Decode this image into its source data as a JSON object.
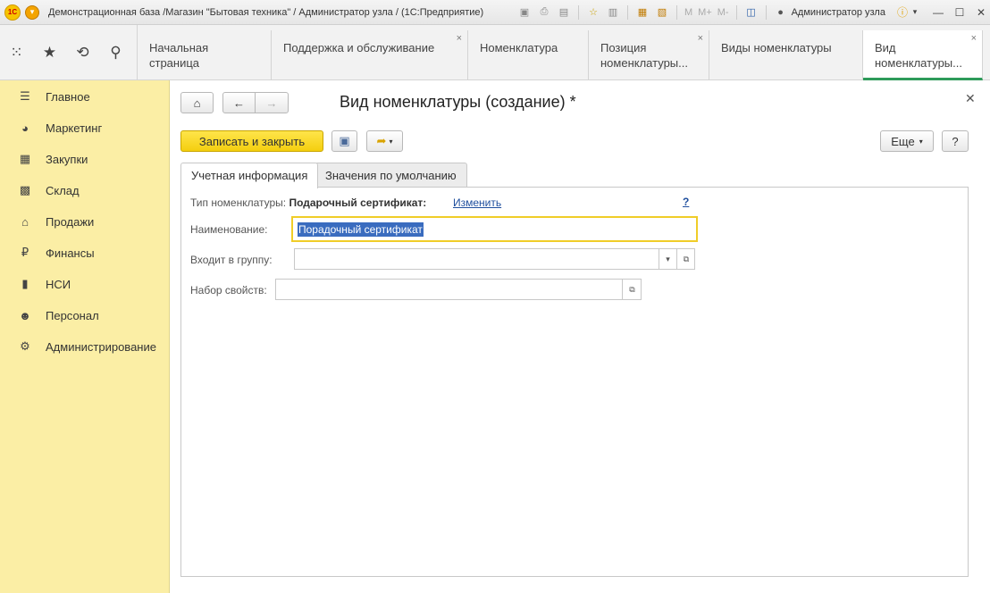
{
  "window": {
    "title": "Демонстрационная база /Магазин \"Бытовая техника\" / Администратор узла /  (1С:Предприятие)",
    "user": "Администратор узла",
    "toolbar_text": [
      "M",
      "M+",
      "M-"
    ]
  },
  "tabs": [
    {
      "label": "Начальная страница",
      "closable": false
    },
    {
      "label": "Поддержка и обслуживание",
      "closable": true
    },
    {
      "label": "Номенклатура",
      "closable": false
    },
    {
      "label": "Позиция номенклатуры...",
      "closable": true
    },
    {
      "label": "Виды номенклатуры",
      "closable": false
    },
    {
      "label": "Вид номенклатуры...",
      "closable": true,
      "active": true
    }
  ],
  "sidebar": {
    "items": [
      {
        "label": "Главное",
        "icon": "menu-lines-icon"
      },
      {
        "label": "Маркетинг",
        "icon": "pie-chart-icon"
      },
      {
        "label": "Закупки",
        "icon": "cart-icon"
      },
      {
        "label": "Склад",
        "icon": "warehouse-grid-icon"
      },
      {
        "label": "Продажи",
        "icon": "basket-icon"
      },
      {
        "label": "Финансы",
        "icon": "ruble-coin-icon"
      },
      {
        "label": "НСИ",
        "icon": "books-icon"
      },
      {
        "label": "Персонал",
        "icon": "person-icon"
      },
      {
        "label": "Администрирование",
        "icon": "gear-icon"
      }
    ]
  },
  "form": {
    "title": "Вид номенклатуры  (создание) *",
    "save_close_label": "Записать и закрыть",
    "more_label": "Еще",
    "help_label": "?",
    "tabs": [
      {
        "label": "Учетная информация",
        "active": true
      },
      {
        "label": "Значения по умолчанию",
        "active": false
      }
    ],
    "type_label": "Тип номенклатуры:",
    "type_value": "Подарочный сертификат:",
    "change_link": "Изменить",
    "help_link": "?",
    "name_label": "Наименование:",
    "name_value": "Порадочный сертификат",
    "group_label": "Входит в группу:",
    "group_value": "",
    "props_label": "Набор свойств:",
    "props_value": ""
  },
  "colors": {
    "sidebar_bg": "#fbeea5",
    "primary_button": "#f4cf0f",
    "active_tab_underline": "#2e9b5a",
    "link": "#1f4f9e",
    "selection": "#3a6cbf"
  }
}
